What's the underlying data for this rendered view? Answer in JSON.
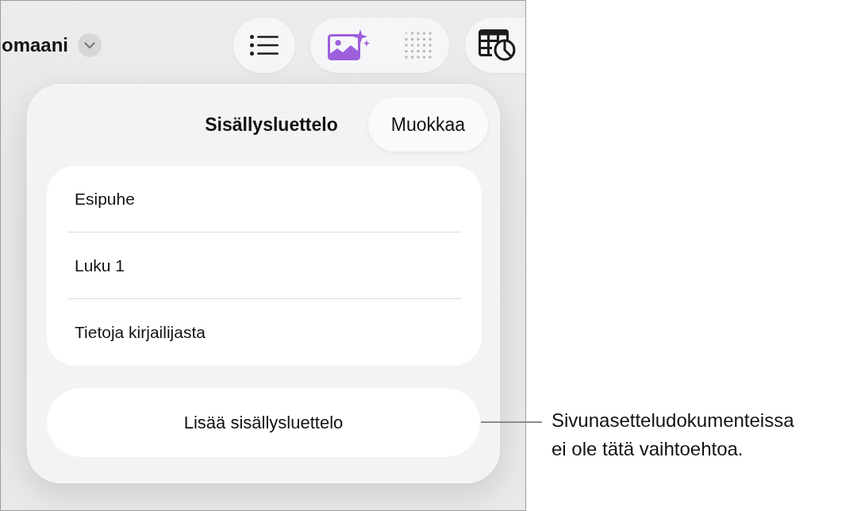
{
  "document_title": "omaani",
  "popover": {
    "title": "Sisällysluettelo",
    "edit_button": "Muokkaa",
    "entries": [
      {
        "label": "Esipuhe"
      },
      {
        "label": "Luku 1"
      },
      {
        "label": "Tietoja kirjailijasta"
      }
    ],
    "add_button": "Lisää sisällysluettelo"
  },
  "callout": "Sivunasetteludokumenteissa ei ole tätä vaihtoehtoa."
}
